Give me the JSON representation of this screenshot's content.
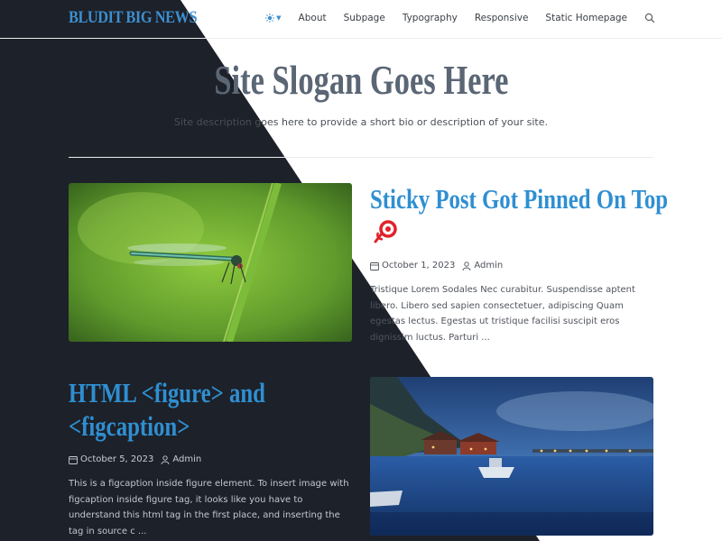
{
  "header": {
    "brand": "BLUDIT BIG NEWS",
    "nav": [
      {
        "label": "About"
      },
      {
        "label": "Subpage"
      },
      {
        "label": "Typography"
      },
      {
        "label": "Responsive"
      },
      {
        "label": "Static Homepage"
      }
    ],
    "theme_icon": "sun-icon",
    "search_icon": "search-icon"
  },
  "hero": {
    "slogan": "Site Slogan Goes Here",
    "description": "Site description goes here to provide a short bio or description of your site."
  },
  "posts": [
    {
      "title_lines": [
        "Sticky Post Got Pinned On Top"
      ],
      "pin_icon": "pin-icon",
      "date": "October 1, 2023",
      "author": "Admin",
      "excerpt": "Tristique Lorem Sodales Nec curabitur. Suspendisse aptent libero. Libero sed sapien consectetuer, adipiscing Quam egestas lectus. Egestas ut tristique facilisi suscipit eros dignissim luctus. Parturi ..."
    },
    {
      "title_lines": [
        "HTML <figure> and",
        "<figcaption>"
      ],
      "date": "October 5, 2023",
      "author": "Admin",
      "excerpt": "This is a figcaption inside figure element. To insert image with figcaption inside figure tag, it looks like you have to understand this html tag in the first place, and inserting the tag in source c ..."
    }
  ],
  "colors": {
    "dark_bg": "#1d2129",
    "accent": "#2f8fd2",
    "slogan": "#5b6675"
  }
}
